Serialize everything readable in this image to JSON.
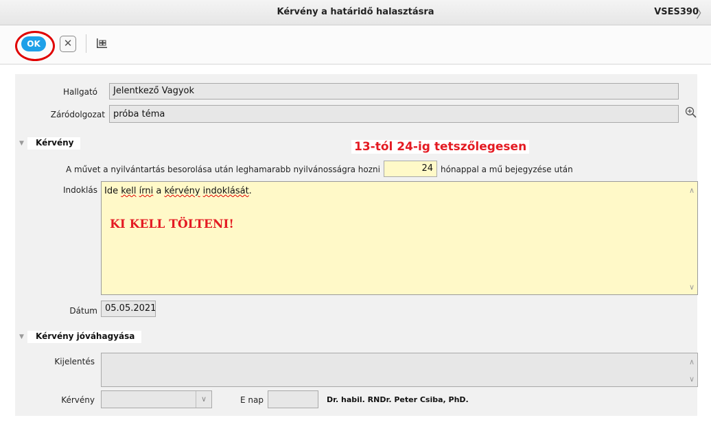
{
  "window": {
    "title": "Kérvény a határidő halasztásra",
    "code": "VSES390"
  },
  "toolbar": {
    "ok_label": "OK",
    "cancel_icon": "close-icon",
    "grid_icon": "grid-icon",
    "highlight_color": "#e00000",
    "ok_color": "#1ea0e8"
  },
  "student": {
    "label": "Hallgató",
    "value": "Jelentkező Vagyok"
  },
  "thesis": {
    "label": "Záródolgozat",
    "value": "próba téma",
    "zoom_icon": "zoom-in-icon"
  },
  "request_section": {
    "title": "Kérvény",
    "note": "13-tól 24-ig tetszőlegesen",
    "note_color": "#e41b23",
    "months_label": "A művet a nyilvántartás besorolása után leghamarabb nyilvánosságra hozni",
    "months_value": "24",
    "months_suffix": "hónappal a mű bejegyzése után",
    "reason_label": "Indoklás",
    "reason_text_a": "Ide ",
    "reason_text_b": "kell",
    "reason_text_c": " ",
    "reason_text_d": "írni",
    "reason_text_e": " a ",
    "reason_text_f": "kérvény",
    "reason_text_g": " ",
    "reason_text_h": "indoklását",
    "reason_text_i": ".",
    "reason_warning": "KI KELL TÖLTENI!",
    "date_label": "Dátum",
    "date_value": "05.05.2021"
  },
  "approval_section": {
    "title": "Kérvény jóváhagyása",
    "statement_label": "Kijelentés",
    "request_label": "Kérvény",
    "enap_label": "E nap",
    "approver_name": "Dr. habil. RNDr. Peter Csiba, PhD."
  }
}
